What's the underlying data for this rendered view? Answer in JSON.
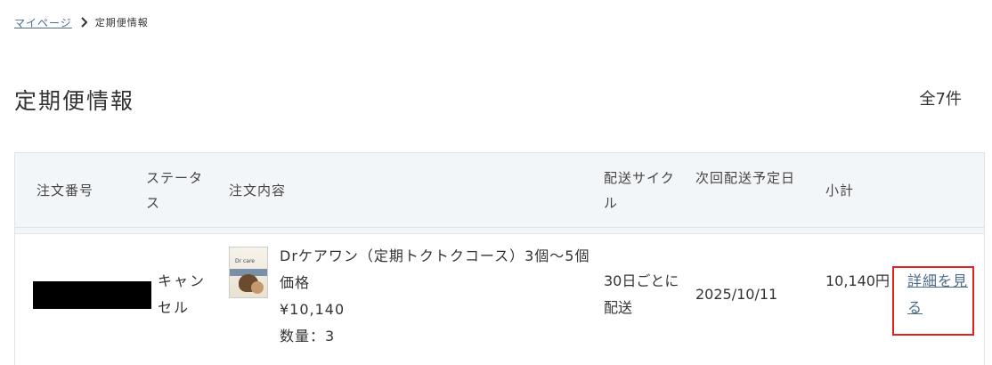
{
  "breadcrumb": {
    "home_label": "マイページ",
    "separator_icon": "chevron-right-icon",
    "current_label": "定期便情報"
  },
  "page": {
    "title": "定期便情報",
    "total_count": "全7件"
  },
  "table": {
    "headers": {
      "order_no": "注文番号",
      "status": "ステータス",
      "content": "注文内容",
      "cycle": "配送サイクル",
      "next_delivery": "次回配送予定日",
      "subtotal": "小計"
    },
    "rows": [
      {
        "order_no": "",
        "status": "キャンセル",
        "product_name": "Drケアワン（定期トクトクコース）3個～5個価格",
        "price": "¥10,140",
        "quantity": "数量：3",
        "cycle": "30日ごとに配送",
        "next_delivery": "2025/10/11",
        "subtotal": "10,140円",
        "detail_link": "詳細を見る"
      }
    ]
  }
}
